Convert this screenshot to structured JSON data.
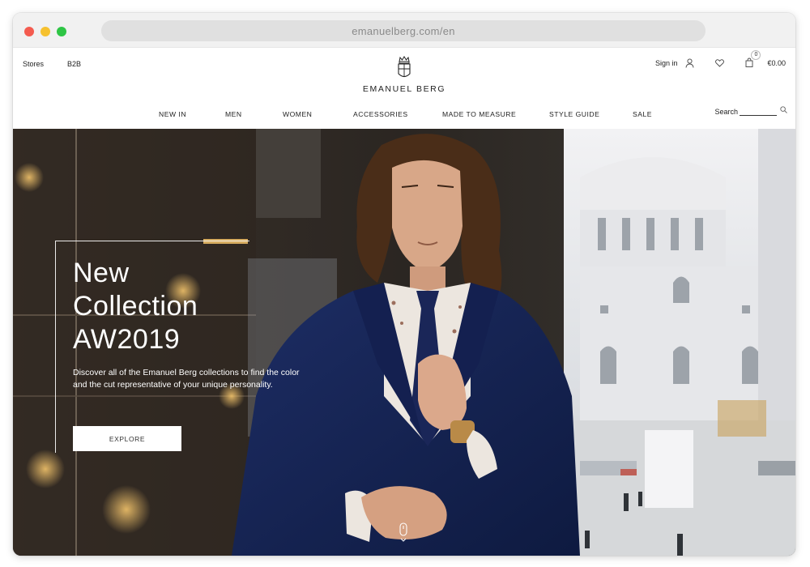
{
  "browser": {
    "url": "emanuelberg.com/en"
  },
  "header": {
    "top_left": [
      "Stores",
      "B2B"
    ],
    "brand": "EMANUEL BERG",
    "sign_in": "Sign in",
    "cart_count": "0",
    "cart_total": "€0.00",
    "icons": {
      "user": "user-icon",
      "wishlist": "heart-icon",
      "cart": "shopping-bag-icon",
      "search": "search-icon",
      "logo": "crown-crest-icon"
    }
  },
  "nav": {
    "items": [
      "NEW IN",
      "MEN",
      "WOMEN",
      "ACCESSORIES",
      "MADE TO MEASURE",
      "STYLE GUIDE",
      "SALE"
    ],
    "search_label": "Search"
  },
  "hero": {
    "title_lines": [
      "New",
      "Collection",
      "AW2019"
    ],
    "description": "Discover all of the Emanuel Berg collections to find the color and the cut representative of your unique personality.",
    "cta": "EXPLORE"
  },
  "colors": {
    "window_red": "#f45b4f",
    "window_yellow": "#f6c12f",
    "window_green": "#2ec545",
    "suit_navy": "#13214f"
  }
}
